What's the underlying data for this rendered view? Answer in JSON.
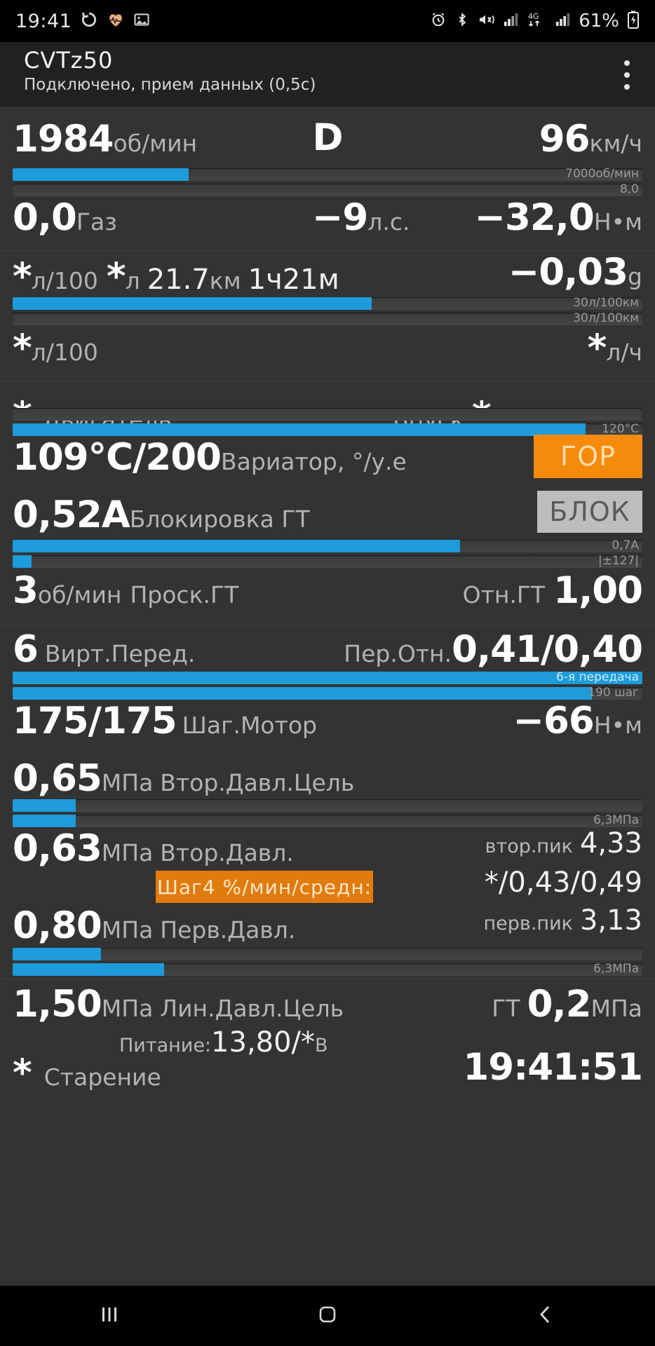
{
  "statusbar": {
    "time": "19:41",
    "battery_pct": "61%",
    "network": "4G",
    "icons": [
      "rotate-icon",
      "heart-rate-icon",
      "photo-icon",
      "alarm-icon",
      "bluetooth-icon",
      "mute-vibrate-icon",
      "signal-icon",
      "network-4g-icon",
      "signal2-icon",
      "battery-charging-icon"
    ]
  },
  "header": {
    "title": "CVTz50",
    "subtitle": "Подключено, прием данных (0,5с)",
    "menu_icon": "kebab-menu-icon"
  },
  "rows": {
    "rpm": {
      "value": "1984",
      "unit": "об/мин",
      "gear": "D",
      "speed": "96",
      "speed_unit": "км/ч"
    },
    "bar_rpm": {
      "cap": "7000об/мин",
      "pct": 28
    },
    "bar_speed": {
      "cap": "8,0",
      "pct": 0
    },
    "throttle": {
      "value": "0,0",
      "label": "Газ",
      "power": "−9",
      "power_unit": "л.с.",
      "torque": "−32,0",
      "torque_unit": "Н•м"
    },
    "trip": {
      "lpkm": "*",
      "lpkm_unit": "л/100",
      "liters": "*",
      "liters_unit": "л",
      "distance": "21.7",
      "distance_unit": "км",
      "time": "1ч21м",
      "accel": "−0,03",
      "accel_unit": "g"
    },
    "bar_trip1": {
      "cap": "30л/100км",
      "pct": 57
    },
    "bar_trip2": {
      "cap": "30л/100км",
      "pct": 0
    },
    "avg": {
      "left_value": "*",
      "left_unit": "л/100",
      "right_value": "*",
      "right_unit": "л/ч"
    },
    "engine": {
      "star": "*",
      "label": "Двигатель",
      "intake_label": "Впуск:",
      "intake_value": "*"
    },
    "bar_engine": {
      "cap": "",
      "pct": 0
    },
    "bar_temp": {
      "cap": "120°C",
      "pct": 91
    },
    "variator": {
      "value": "109°C/200",
      "label": "Вариатор, °/у.е",
      "badge": "ГОР"
    },
    "lockup": {
      "value": "0,52A",
      "label": "Блокировка ГТ",
      "badge": "БЛОК"
    },
    "bar_lock1": {
      "cap": "0,7A",
      "pct": 71
    },
    "bar_lock2": {
      "cap": "|±127|",
      "pct": 3
    },
    "slip": {
      "value": "3",
      "unit": "об/мин",
      "label": "Проск.ГТ",
      "ratio_label": "Отн.ГТ",
      "ratio_value": "1,00"
    },
    "virtgear": {
      "value": "6",
      "label": "Вирт.Перед.",
      "ratio_label": "Пер.Отн.",
      "ratio_value": "0,41/0,40"
    },
    "bar_gear": {
      "cap": "6-я передача",
      "pct": 100
    },
    "bar_step": {
      "cap": "190 шаг",
      "pct": 92
    },
    "stepmotor": {
      "value": "175/175",
      "label": "Шаг.Мотор",
      "torque": "−66",
      "torque_unit": "Н•м"
    },
    "sec_target": {
      "value": "0,65",
      "unit": "МПа",
      "label": "Втор.Давл.Цель"
    },
    "bar_sec1": {
      "cap": "",
      "pct": 10
    },
    "bar_sec2": {
      "cap": "6,3МПа",
      "pct": 10
    },
    "sec_press": {
      "value": "0,63",
      "unit": "МПа",
      "label": "Втор.Давл.",
      "peak_label": "втор.пик",
      "peak_value": "4,33"
    },
    "step_badge": {
      "text": "Шаг4 %/мин/средн:",
      "values": "*/0,43/0,49"
    },
    "prim_press": {
      "value": "0,80",
      "unit": "МПа",
      "label": "Перв.Давл.",
      "peak_label": "перв.пик",
      "peak_value": "3,13"
    },
    "bar_prim1": {
      "cap": "",
      "pct": 14
    },
    "bar_prim2": {
      "cap": "6,3МПа",
      "pct": 24
    },
    "line_target": {
      "value": "1,50",
      "unit": "МПа",
      "label": "Лин.Давл.Цель",
      "gt_label": "ГТ",
      "gt_value": "0,2",
      "gt_unit": "МПа"
    },
    "power_supply": {
      "label": "Питание:",
      "value": "13,80/*",
      "unit": "В"
    },
    "aging": {
      "star": "*",
      "label": "Старение",
      "clock": "19:41:51"
    }
  },
  "navbar": {
    "recents_icon": "recents-icon",
    "home_icon": "home-icon",
    "back_icon": "back-icon"
  },
  "colors": {
    "accent": "#1d9bdb",
    "hot": "#f58a0b",
    "lock": "#bdbdbd",
    "bg": "#333333"
  }
}
